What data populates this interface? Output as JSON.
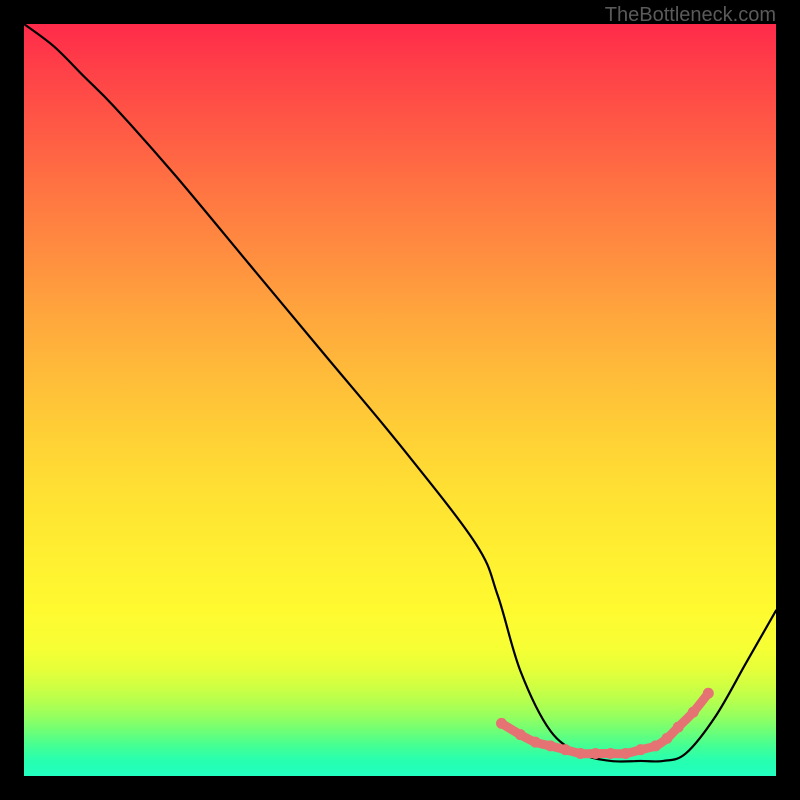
{
  "attribution": "TheBottleneck.com",
  "chart_data": {
    "type": "line",
    "title": "",
    "xlabel": "",
    "ylabel": "",
    "xlim": [
      0,
      100
    ],
    "ylim": [
      0,
      100
    ],
    "series": [
      {
        "name": "bottleneck-curve",
        "x": [
          0,
          4,
          8,
          12,
          20,
          30,
          40,
          50,
          60,
          63,
          66,
          70,
          74,
          78,
          82,
          85,
          88,
          92,
          96,
          100
        ],
        "y": [
          100,
          97,
          93,
          89,
          80,
          68,
          56,
          44,
          31,
          24,
          14,
          6,
          3,
          2,
          2,
          2,
          3,
          8,
          15,
          22
        ],
        "color": "#000000"
      }
    ],
    "markers": [
      {
        "name": "highlighted-points",
        "x": [
          63.5,
          66,
          68,
          70,
          72,
          74,
          76,
          78,
          80,
          82,
          84,
          85.5,
          87,
          89,
          91
        ],
        "y": [
          7,
          5.5,
          4.5,
          4,
          3.5,
          3,
          3,
          3,
          3,
          3.5,
          4,
          5,
          6.5,
          8.5,
          11
        ],
        "color": "#e57373"
      }
    ],
    "gradient": {
      "top_color": "#ff2a4a",
      "bottom_color": "#22ffc0",
      "description": "red-to-green vertical gradient representing bottleneck severity"
    }
  }
}
